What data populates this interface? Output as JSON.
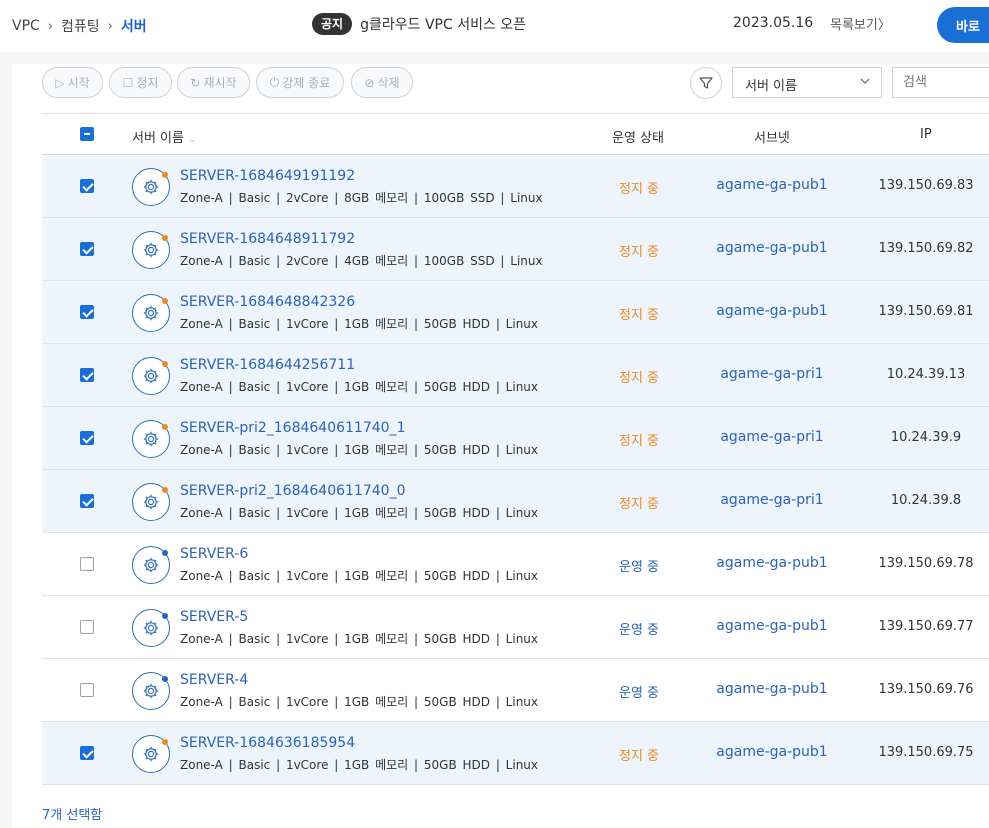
{
  "breadcrumb": {
    "items": [
      "VPC",
      "컴퓨팅"
    ],
    "current": "서버"
  },
  "notice": {
    "badge": "공지",
    "text": "g클라우드 VPC 서비스 오픈",
    "date": "2023.05.16",
    "list_link": "목록보기〉"
  },
  "header": {
    "action_button": "바로"
  },
  "toolbar": {
    "start": "시작",
    "stop": "정지",
    "restart": "재시작",
    "force_stop": "강제 종료",
    "delete": "삭제",
    "search_field": "서버 이름",
    "search_placeholder": "검색"
  },
  "table": {
    "columns": {
      "name": "서버 이름",
      "status": "운영 상태",
      "subnet": "서브넷",
      "ip": "IP"
    },
    "rows": [
      {
        "name": "SERVER-1684649191192",
        "spec": "Zone-A | Basic | 2vCore | 8GB 메모리 | 100GB SSD | Linux",
        "status": "정지 중",
        "subnet": "agame-ga-pub1",
        "ip": "139.150.69.83",
        "checked": true
      },
      {
        "name": "SERVER-1684648911792",
        "spec": "Zone-A | Basic | 2vCore | 4GB 메모리 | 100GB SSD | Linux",
        "status": "정지 중",
        "subnet": "agame-ga-pub1",
        "ip": "139.150.69.82",
        "checked": true
      },
      {
        "name": "SERVER-1684648842326",
        "spec": "Zone-A | Basic | 1vCore | 1GB 메모리 | 50GB HDD | Linux",
        "status": "정지 중",
        "subnet": "agame-ga-pub1",
        "ip": "139.150.69.81",
        "checked": true
      },
      {
        "name": "SERVER-1684644256711",
        "spec": "Zone-A | Basic | 1vCore | 1GB 메모리 | 50GB HDD | Linux",
        "status": "정지 중",
        "subnet": "agame-ga-pri1",
        "ip": "10.24.39.13",
        "checked": true
      },
      {
        "name": "SERVER-pri2_1684640611740_1",
        "spec": "Zone-A | Basic | 1vCore | 1GB 메모리 | 50GB HDD | Linux",
        "status": "정지 중",
        "subnet": "agame-ga-pri1",
        "ip": "10.24.39.9",
        "checked": true
      },
      {
        "name": "SERVER-pri2_1684640611740_0",
        "spec": "Zone-A | Basic | 1vCore | 1GB 메모리 | 50GB HDD | Linux",
        "status": "정지 중",
        "subnet": "agame-ga-pri1",
        "ip": "10.24.39.8",
        "checked": true
      },
      {
        "name": "SERVER-6",
        "spec": "Zone-A | Basic | 1vCore | 1GB 메모리 | 50GB HDD | Linux",
        "status": "운영 중",
        "subnet": "agame-ga-pub1",
        "ip": "139.150.69.78",
        "checked": false
      },
      {
        "name": "SERVER-5",
        "spec": "Zone-A | Basic | 1vCore | 1GB 메모리 | 50GB HDD | Linux",
        "status": "운영 중",
        "subnet": "agame-ga-pub1",
        "ip": "139.150.69.77",
        "checked": false
      },
      {
        "name": "SERVER-4",
        "spec": "Zone-A | Basic | 1vCore | 1GB 메모리 | 50GB HDD | Linux",
        "status": "운영 중",
        "subnet": "agame-ga-pub1",
        "ip": "139.150.69.76",
        "checked": false
      },
      {
        "name": "SERVER-1684636185954",
        "spec": "Zone-A | Basic | 1vCore | 1GB 메모리 | 50GB HDD | Linux",
        "status": "정지 중",
        "subnet": "agame-ga-pub1",
        "ip": "139.150.69.75",
        "checked": true
      }
    ]
  },
  "selection_summary": "7개 선택함",
  "colors": {
    "accent": "#1a6fd6",
    "stopped": "#ee8a1e",
    "running": "#2a63b8",
    "selected_row": "#eef4fc"
  }
}
